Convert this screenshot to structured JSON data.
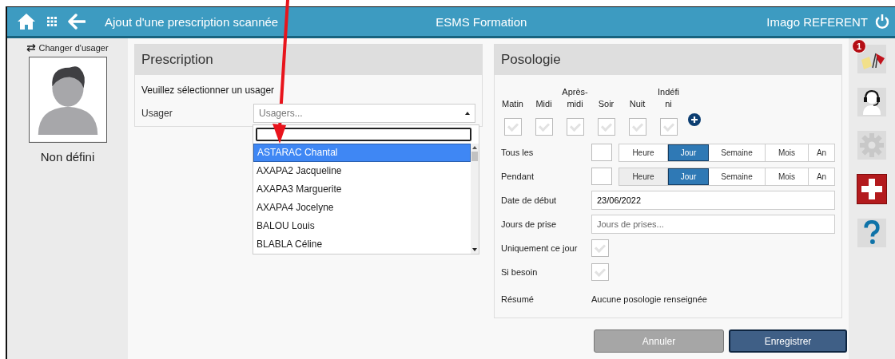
{
  "header": {
    "title": "Ajout d'une prescription scannée",
    "center": "ESMS Formation",
    "user": "Imago REFERENT"
  },
  "patient": {
    "change_link": "Changer d'usager",
    "name": "Non défini"
  },
  "prescription": {
    "title": "Prescription",
    "instruction": "Veuillez sélectionner un usager",
    "field_label": "Usager",
    "placeholder": "Usagers...",
    "expanded": true,
    "options": [
      {
        "label": "ASTARAC Chantal",
        "selected": true
      },
      {
        "label": "AXAPA2 Jacqueline",
        "selected": false
      },
      {
        "label": "AXAPA3 Marguerite",
        "selected": false
      },
      {
        "label": "AXAPA4 Jocelyne",
        "selected": false
      },
      {
        "label": "BALOU Louis",
        "selected": false
      },
      {
        "label": "BLABLA Céline",
        "selected": false
      }
    ]
  },
  "posologie": {
    "title": "Posologie",
    "moments": [
      {
        "label": "Matin",
        "checked": false
      },
      {
        "label": "Midi",
        "checked": false
      },
      {
        "label": "Après-\nmidi",
        "checked": false
      },
      {
        "label": "Soir",
        "checked": false
      },
      {
        "label": "Nuit",
        "checked": false
      },
      {
        "label": "Indéfi\nni",
        "checked": false
      }
    ],
    "periods": [
      {
        "label": "Tous les",
        "units": [
          {
            "label": "Heure",
            "selected": false,
            "hover": false
          },
          {
            "label": "Jour",
            "selected": true,
            "hover": false
          },
          {
            "label": "Semaine",
            "selected": false,
            "hover": false
          },
          {
            "label": "Mois",
            "selected": false,
            "hover": false
          },
          {
            "label": "An",
            "selected": false,
            "hover": false
          }
        ]
      },
      {
        "label": "Pendant",
        "units": [
          {
            "label": "Heure",
            "selected": false,
            "hover": true
          },
          {
            "label": "Jour",
            "selected": true,
            "hover": false
          },
          {
            "label": "Semaine",
            "selected": false,
            "hover": false
          },
          {
            "label": "Mois",
            "selected": false,
            "hover": false
          },
          {
            "label": "An",
            "selected": false,
            "hover": false
          }
        ]
      }
    ],
    "start_date": {
      "label": "Date de début",
      "value": "23/06/2022"
    },
    "days": {
      "label": "Jours de prise",
      "placeholder": "Jours de prises..."
    },
    "flags": [
      {
        "label": "Uniquement ce jour",
        "checked": false
      },
      {
        "label": "Si besoin",
        "checked": false
      }
    ],
    "summary": {
      "label": "Résumé",
      "value": "Aucune posologie renseignée"
    }
  },
  "buttons": [
    {
      "label": "Annuler",
      "kind": "secondary"
    },
    {
      "label": "Enregistrer",
      "kind": "primary"
    }
  ],
  "sidebar": {
    "alert_count": "1"
  }
}
